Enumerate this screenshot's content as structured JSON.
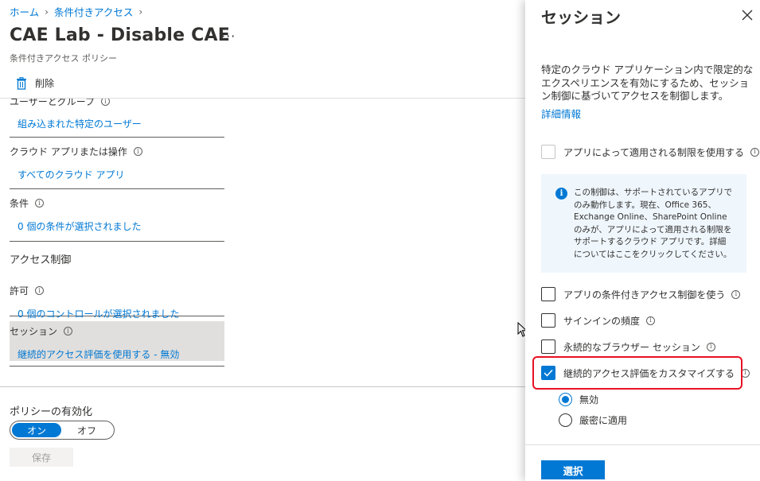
{
  "breadcrumb": [
    {
      "label": "ホーム"
    },
    {
      "label": "条件付きアクセス"
    }
  ],
  "page": {
    "title": "CAE Lab - Disable CAE",
    "more": "···",
    "subtitle": "条件付きアクセス ポリシー"
  },
  "toolbar": {
    "delete_label": "削除"
  },
  "sections": {
    "users": {
      "label": "ユーザーとグループ",
      "value": "組み込まれた特定のユーザー"
    },
    "apps": {
      "label": "クラウド アプリまたは操作",
      "value": "すべてのクラウド アプリ"
    },
    "conditions": {
      "label": "条件",
      "value": "0 個の条件が選択されました"
    },
    "access_heading": "アクセス制御",
    "grant": {
      "label": "許可",
      "value": "0 個のコントロールが選択されました"
    },
    "session": {
      "label": "セッション",
      "value": "継続的アクセス評価を使用する - 無効"
    }
  },
  "policy": {
    "label": "ポリシーの有効化",
    "on": "オン",
    "off": "オフ",
    "save": "保存"
  },
  "panel": {
    "title": "セッション",
    "description": "特定のクラウド アプリケーション内で限定的なエクスペリエンスを有効にするため、セッション制御に基づいてアクセスを制御します。",
    "learn_more": "詳細情報",
    "app_enforced": "アプリによって適用される制限を使用する",
    "info_text": "この制御は、サポートされているアプリでのみ動作します。現在、Office 365、Exchange Online、SharePoint Online のみが、アプリによって適用される制限をサポートするクラウド アプリです。詳細についてはここをクリックしてください。",
    "options": [
      {
        "label": "アプリの条件付きアクセス制御を使う",
        "checked": false
      },
      {
        "label": "サインインの頻度",
        "checked": false
      },
      {
        "label": "永続的なブラウザー セッション",
        "checked": false
      },
      {
        "label": "継続的アクセス評価をカスタマイズする",
        "checked": true
      }
    ],
    "radios": [
      {
        "label": "無効",
        "selected": true
      },
      {
        "label": "厳密に適用",
        "selected": false
      }
    ],
    "select": "選択"
  },
  "colors": {
    "accent": "#0078d4",
    "highlight": "#e81123"
  }
}
